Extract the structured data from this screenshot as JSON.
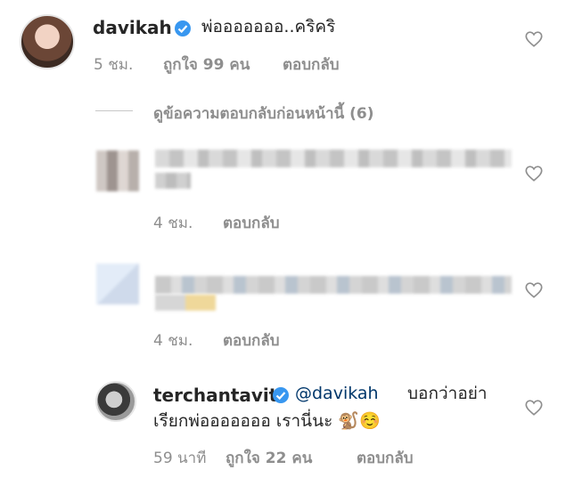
{
  "comments": [
    {
      "username": "davikah",
      "text": "พ่อออออออ..คริคริ",
      "time": "5 ชม.",
      "likes": "ถูกใจ 99 คน",
      "reply_label": "ตอบกลับ"
    },
    {
      "username": "terchantavit",
      "mention": "@davikah",
      "text_line1": "บอกว่าอย่า",
      "text_line2": "เรียกพ่อออออออ เรานี่นะ 🐒☺️",
      "time": "59 นาที",
      "likes": "ถูกใจ 22 คน",
      "reply_label": "ตอบกลับ"
    }
  ],
  "view_previous_replies": "ดูข้อความตอบกลับก่อนหน้านี้ (6)",
  "blurred_replies": [
    {
      "time": "4 ชม.",
      "reply_label": "ตอบกลับ"
    },
    {
      "time": "4 ชม.",
      "reply_label": "ตอบกลับ"
    }
  ],
  "colors": {
    "text": "#262626",
    "secondary": "#8e8e8e",
    "verified": "#3897f0",
    "mention": "#00376b"
  },
  "icons": [
    "heart-outline-icon",
    "verified-badge-icon"
  ]
}
